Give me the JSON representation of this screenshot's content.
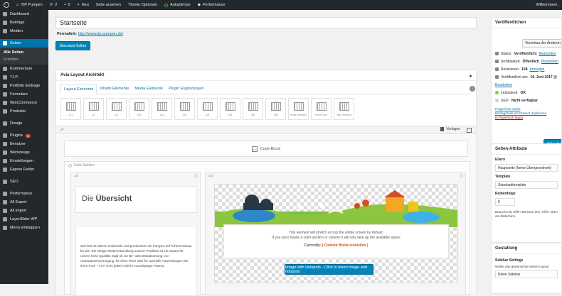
{
  "adminbar": {
    "wp_logo": "wordpress-icon",
    "site_name": "TIP Pumpen",
    "updates_count": "2",
    "comments_count": "0",
    "new_label": "Neu",
    "view_page": "Seite ansehen",
    "theme_options": "Theme Optionen",
    "autoptimize": "Autoptimize",
    "performance": "Performance",
    "greeting": "Willkommen,"
  },
  "sidebar": {
    "items": [
      {
        "label": "Dashboard",
        "icon": "dashboard-icon"
      },
      {
        "label": "Beiträge",
        "icon": "pin-icon"
      },
      {
        "label": "Medien",
        "icon": "media-icon"
      },
      {
        "label": "Seiten",
        "icon": "page-icon",
        "active": true
      },
      {
        "label": "Kommentare",
        "icon": "comment-icon"
      },
      {
        "label": "T.I.P.",
        "icon": "star-icon"
      },
      {
        "label": "Portfolio Einträge",
        "icon": "portfolio-icon"
      },
      {
        "label": "Formulare",
        "icon": "form-icon"
      },
      {
        "label": "WooCommerce",
        "icon": "woocommerce-icon"
      },
      {
        "label": "Produkte",
        "icon": "product-icon"
      },
      {
        "label": "Design",
        "icon": "brush-icon"
      },
      {
        "label": "Plugins",
        "icon": "plugin-icon",
        "badge": "1"
      },
      {
        "label": "Benutzer",
        "icon": "user-icon"
      },
      {
        "label": "Werkzeuge",
        "icon": "tools-icon"
      },
      {
        "label": "Einstellungen",
        "icon": "settings-icon"
      },
      {
        "label": "Eigene Felder",
        "icon": "fields-icon"
      },
      {
        "label": "SEO",
        "icon": "seo-icon"
      },
      {
        "label": "Performance",
        "icon": "performance-icon"
      },
      {
        "label": "All Export",
        "icon": "export-icon"
      },
      {
        "label": "All Import",
        "icon": "import-icon"
      },
      {
        "label": "LayerSlider WP",
        "icon": "layers-icon"
      },
      {
        "label": "Menü einklappen",
        "icon": "collapse-icon"
      }
    ],
    "submenu": [
      "Alle Seiten",
      "Erstellen"
    ]
  },
  "editor": {
    "title": "Startseite",
    "permalink_label": "Permalink:",
    "permalink_url": "http://www.tip-pumpen.de/",
    "standard_editor": "Standard Editor"
  },
  "avia": {
    "title": "Avia Layout Architekt",
    "toggle": "▴",
    "help": "i",
    "tabs": [
      "Layout Elemente",
      "Inhalts Elemente",
      "Media Elemente",
      "Plugin Ergänzungen"
    ],
    "elements": [
      "1/1",
      "1/2",
      "1/3",
      "2/3",
      "1/4",
      "3/4",
      "1/5",
      "2/5",
      "3/5",
      "4/5",
      "Farb-Sektion",
      "Grid Row",
      "Tab Section"
    ],
    "templates_label": "Vorlagen",
    "undo": "↶",
    "code_block": "Code-Block",
    "color_section": "Farb-Sektion",
    "col1_label": "1/3",
    "col2_label": "2/3",
    "heading_light": "Die ",
    "heading_bold": "Übersicht",
    "text": "Seit fast 40 Jahren entwickeln und produzieren wir Pumpen auf hohem Niveau für Sie. Die stetige Weiterentwicklung unserer Produkte ist ein Garant für unsere hohe Qualität. Egal ob zur Be- oder Entwässerung, zur Hauswasserversorgung, für Ihren Teich oder für spezielle Anwendungen wie Ihren Pool – T.I.P. ist in jedem Fall Ihr zuverlässiger Partner.",
    "hotspot_note1": "This element will stretch across the whole screen by default.",
    "hotspot_note2": "If you put it inside a color section or column it will only take up the available space",
    "currently_label": "Currently:",
    "currently_value": "| Content Breite einstellen |",
    "hotspot_button": "Image with Hotspots - Click to insert image and hotspots"
  },
  "publish": {
    "title": "Veröffentlichen",
    "preview": "Vorschau der Änderun",
    "status_label": "Status:",
    "status_value": "Veröffentlicht",
    "edit1": "Bearbeiten",
    "visibility_label": "Sichtbarkeit:",
    "visibility_value": "Öffentlich",
    "edit2": "Bearbeiten",
    "revisions_label": "Revisionen:",
    "revisions_value": "108",
    "revisions_link": "Anzeigen",
    "published_label": "Veröffentlicht am:",
    "published_value": "16. Juni 2017 @",
    "edit3": "Bearbeiten",
    "readability_label": "Lesbarkeit:",
    "readability_value": "OK",
    "seo_label": "SEO:",
    "seo_value": "Nicht verfügbar",
    "purge": "Purge from cache",
    "duplicate": "Beitrag/Seite als Entwurf duplizieren",
    "trash": "In Papierkorb legen",
    "update": "Aktualisi"
  },
  "attributes": {
    "title": "Seiten-Attribute",
    "parent_label": "Eltern",
    "parent_value": "Hauptseite (keine Übergeordnete)",
    "template_label": "Template",
    "template_value": "Standardtemplate",
    "order_label": "Reihenfolge",
    "order_value": "0",
    "help": "Brauchst du Hilfe? Benutze den „Hilfe“ oben am Bildschirm."
  },
  "layout_box": {
    "title": "Gestaltung",
    "sidebar_label": "Sidebar Settings",
    "sidebar_help": "Wähle das gewünschte Seiten-Layout",
    "sidebar_value": "Keine Sidebar"
  },
  "colors": {
    "accent": "#0073aa",
    "adminbar": "#23282d",
    "button": "#0085ba",
    "badge": "#d54e21"
  }
}
